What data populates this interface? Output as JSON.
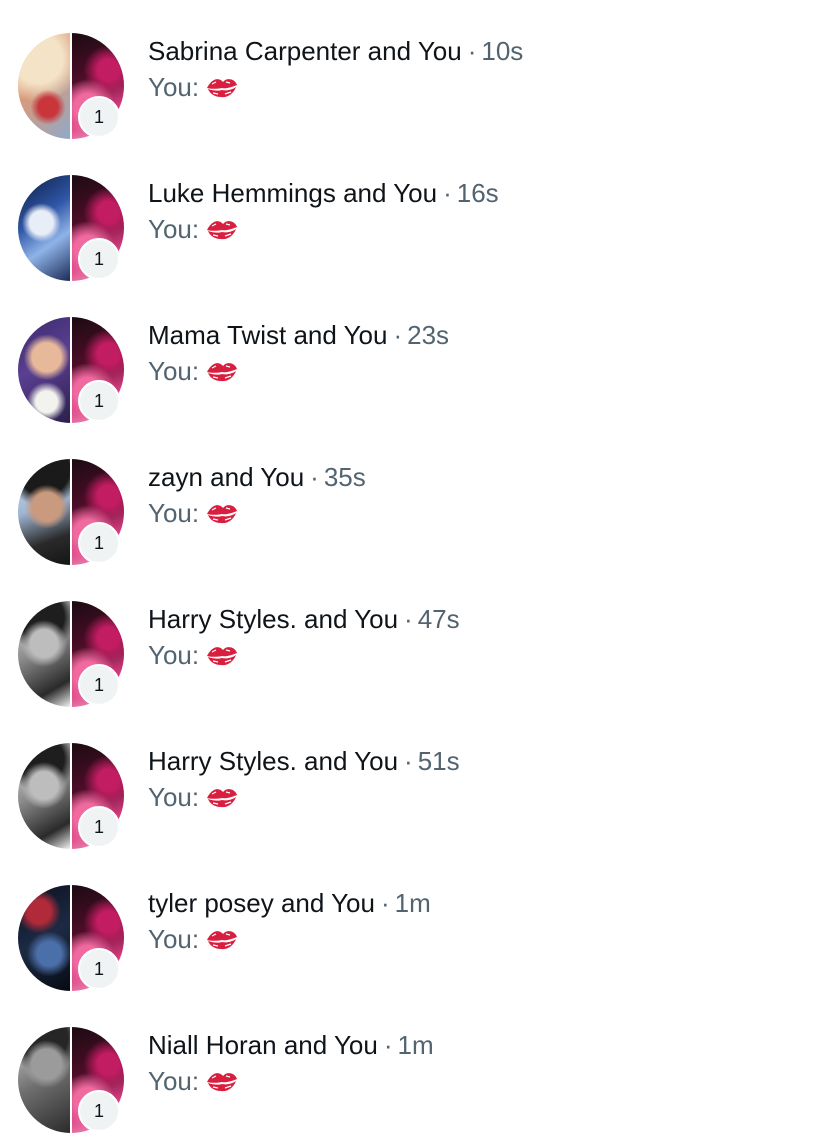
{
  "colors": {
    "primary_text": "#0f1419",
    "secondary_text": "#536471",
    "badge_bg": "#eff3f4",
    "kiss_red": "#d91f3f"
  },
  "conversations": [
    {
      "name": "Sabrina Carpenter and You",
      "time": "10s",
      "preview_prefix": "You:",
      "preview_icon": "kiss-mark-icon",
      "badge": "1"
    },
    {
      "name": "Luke Hemmings and You",
      "time": "16s",
      "preview_prefix": "You:",
      "preview_icon": "kiss-mark-icon",
      "badge": "1"
    },
    {
      "name": "Mama Twist and You",
      "time": "23s",
      "preview_prefix": "You:",
      "preview_icon": "kiss-mark-icon",
      "badge": "1"
    },
    {
      "name": "zayn and You",
      "time": "35s",
      "preview_prefix": "You:",
      "preview_icon": "kiss-mark-icon",
      "badge": "1"
    },
    {
      "name": "Harry Styles. and You",
      "time": "47s",
      "preview_prefix": "You:",
      "preview_icon": "kiss-mark-icon",
      "badge": "1"
    },
    {
      "name": "Harry Styles. and You",
      "time": "51s",
      "preview_prefix": "You:",
      "preview_icon": "kiss-mark-icon",
      "badge": "1"
    },
    {
      "name": "tyler posey and You",
      "time": "1m",
      "preview_prefix": "You:",
      "preview_icon": "kiss-mark-icon",
      "badge": "1"
    },
    {
      "name": "Niall Horan and You",
      "time": "1m",
      "preview_prefix": "You:",
      "preview_icon": "kiss-mark-icon",
      "badge": "1"
    }
  ]
}
